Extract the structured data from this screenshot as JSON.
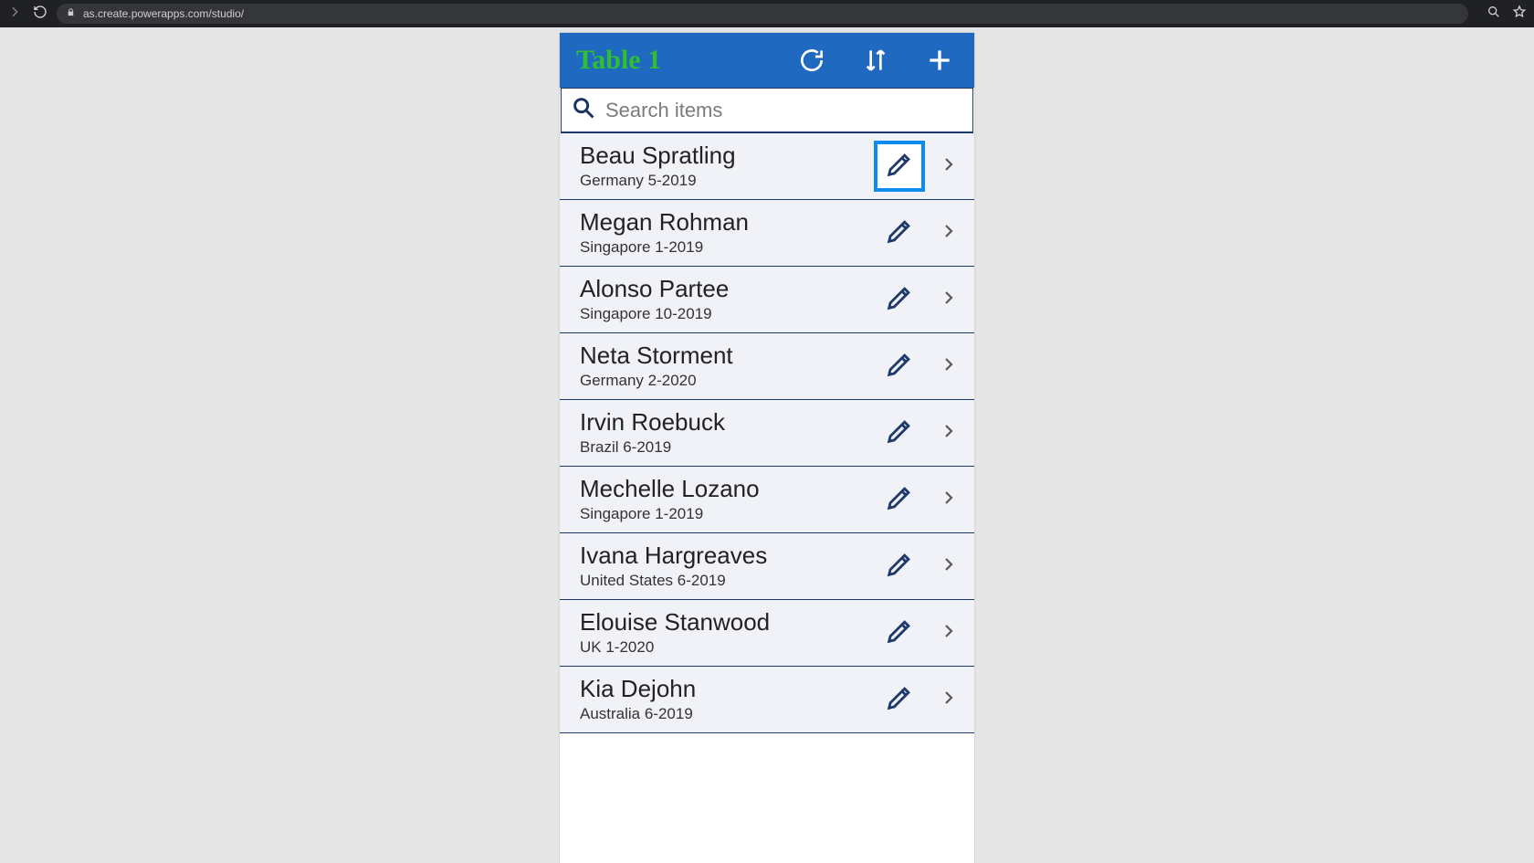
{
  "browser": {
    "url": "as.create.powerapps.com/studio/"
  },
  "app": {
    "title": "Table 1",
    "search": {
      "placeholder": "Search items",
      "value": ""
    },
    "selected_edit_index": 0,
    "items": [
      {
        "name": "Beau Spratling",
        "sub": "Germany 5-2019"
      },
      {
        "name": "Megan Rohman",
        "sub": "Singapore 1-2019"
      },
      {
        "name": "Alonso Partee",
        "sub": "Singapore 10-2019"
      },
      {
        "name": "Neta Storment",
        "sub": "Germany 2-2020"
      },
      {
        "name": "Irvin Roebuck",
        "sub": "Brazil 6-2019"
      },
      {
        "name": "Mechelle Lozano",
        "sub": "Singapore 1-2019"
      },
      {
        "name": "Ivana Hargreaves",
        "sub": "United States 6-2019"
      },
      {
        "name": "Elouise Stanwood",
        "sub": "UK 1-2020"
      },
      {
        "name": "Kia Dejohn",
        "sub": "Australia 6-2019"
      }
    ]
  },
  "colors": {
    "header": "#1f6ac0",
    "accent": "#0d8cf0",
    "ink": "#1f3a6a",
    "title": "#2fbf2f"
  }
}
